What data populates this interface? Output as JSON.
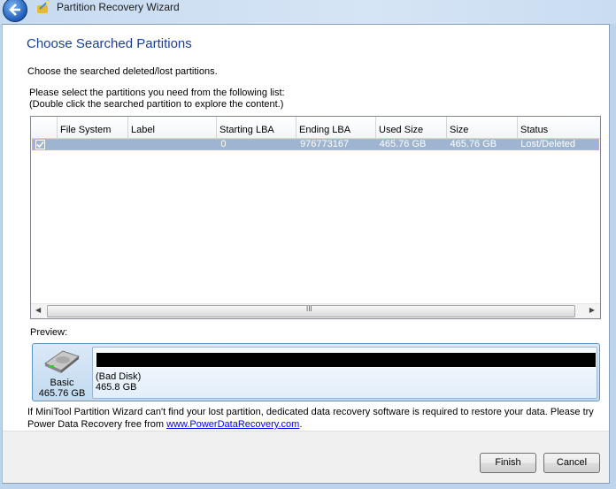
{
  "window": {
    "title": "Partition Recovery Wizard",
    "back_icon": "back-arrow-icon",
    "app_icon": "wizard-icon"
  },
  "page": {
    "heading": "Choose Searched Partitions",
    "subtitle": "Choose the searched deleted/lost partitions.",
    "instruction_line1": "Please select the partitions you need from the following list:",
    "instruction_line2": "(Double click the searched partition to explore the content.)"
  },
  "table": {
    "columns": [
      "",
      "File System",
      "Label",
      "Starting LBA",
      "Ending LBA",
      "Used Size",
      "Size",
      "Status"
    ],
    "rows": [
      {
        "checked": true,
        "file_system": "",
        "label": "",
        "starting_lba": "0",
        "ending_lba": "976773167",
        "used_size": "465.76 GB",
        "size": "465.76 GB",
        "status": "Lost/Deleted"
      }
    ],
    "scroll_thumb_grip": "III"
  },
  "preview": {
    "label": "Preview:",
    "disk_type": "Basic",
    "disk_size": "465.76 GB",
    "partition_name": "(Bad Disk)",
    "partition_size": "465.8 GB"
  },
  "note": {
    "text_before": "If MiniTool Partition Wizard can't find your lost partition, dedicated data recovery software is required to restore your data. Please try Power Data Recovery free from ",
    "link": "www.PowerDataRecovery.com",
    "text_after": "."
  },
  "buttons": {
    "finish": "Finish",
    "cancel": "Cancel"
  }
}
